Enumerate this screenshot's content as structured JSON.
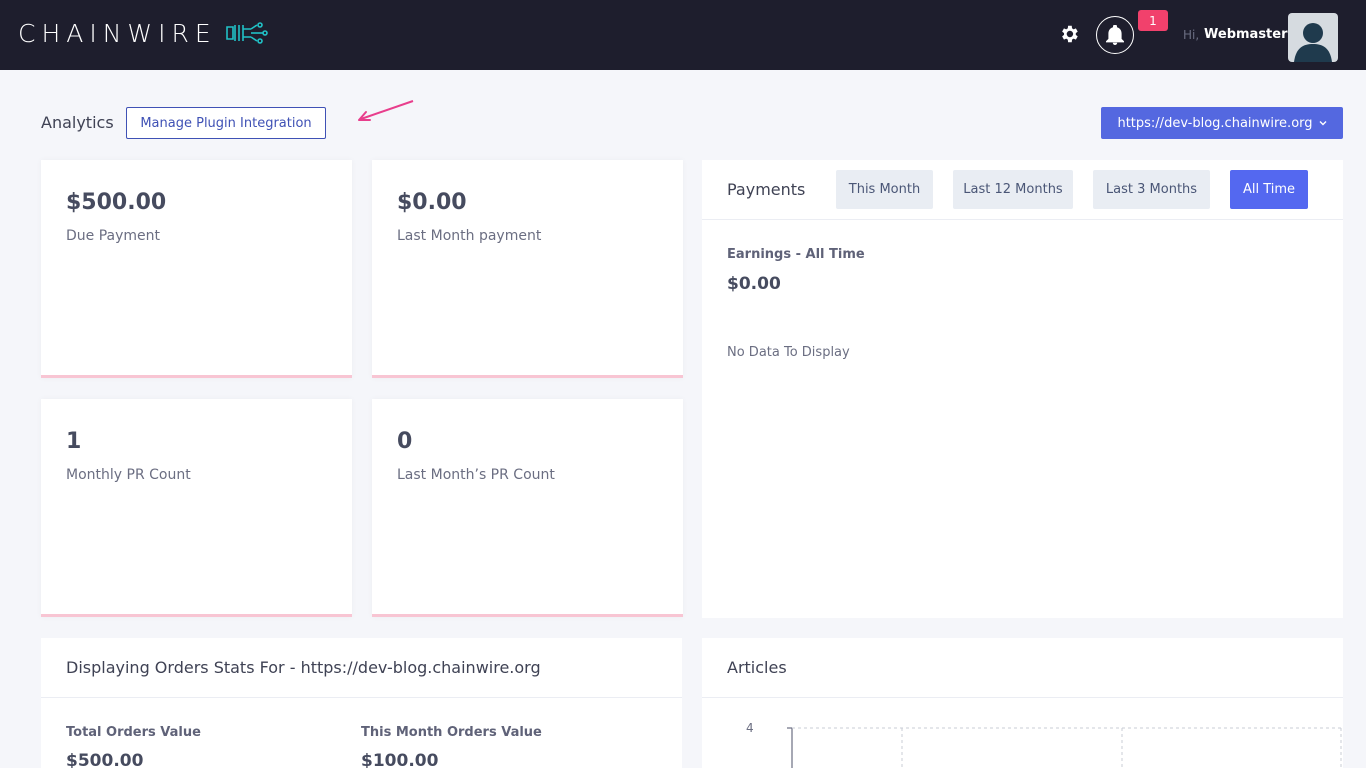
{
  "header": {
    "brand": "CHAINWIRE",
    "notifications_count": "1",
    "greeting": "Hi,",
    "username": "Webmaster"
  },
  "toolbar": {
    "title": "Analytics",
    "manage_button": "Manage Plugin Integration",
    "site_selector": "https://dev-blog.chainwire.org"
  },
  "stats": [
    {
      "value": "$500.00",
      "label": "Due Payment"
    },
    {
      "value": "$0.00",
      "label": "Last Month payment"
    },
    {
      "value": "1",
      "label": "Monthly PR Count"
    },
    {
      "value": "0",
      "label": "Last Month’s PR Count"
    }
  ],
  "payments": {
    "title": "Payments",
    "tabs": [
      "This Month",
      "Last 12 Months",
      "Last 3 Months",
      "All Time"
    ],
    "active_tab": "All Time",
    "earnings_label": "Earnings - All Time",
    "earnings_value": "$0.00",
    "empty_message": "No Data To Display"
  },
  "orders": {
    "title": "Displaying Orders Stats For - https://dev-blog.chainwire.org",
    "total_label": "Total Orders Value",
    "total_value": "$500.00",
    "month_label": "This Month Orders Value",
    "month_value": "$100.00"
  },
  "articles": {
    "title": "Articles",
    "chart_data": {
      "type": "bar",
      "yticks": [
        "4"
      ],
      "grid": true
    }
  },
  "colors": {
    "header_bg": "#1e1e2d",
    "accent": "#5468f0",
    "badge": "#f1416c",
    "card_border": "#f8c5d3"
  }
}
